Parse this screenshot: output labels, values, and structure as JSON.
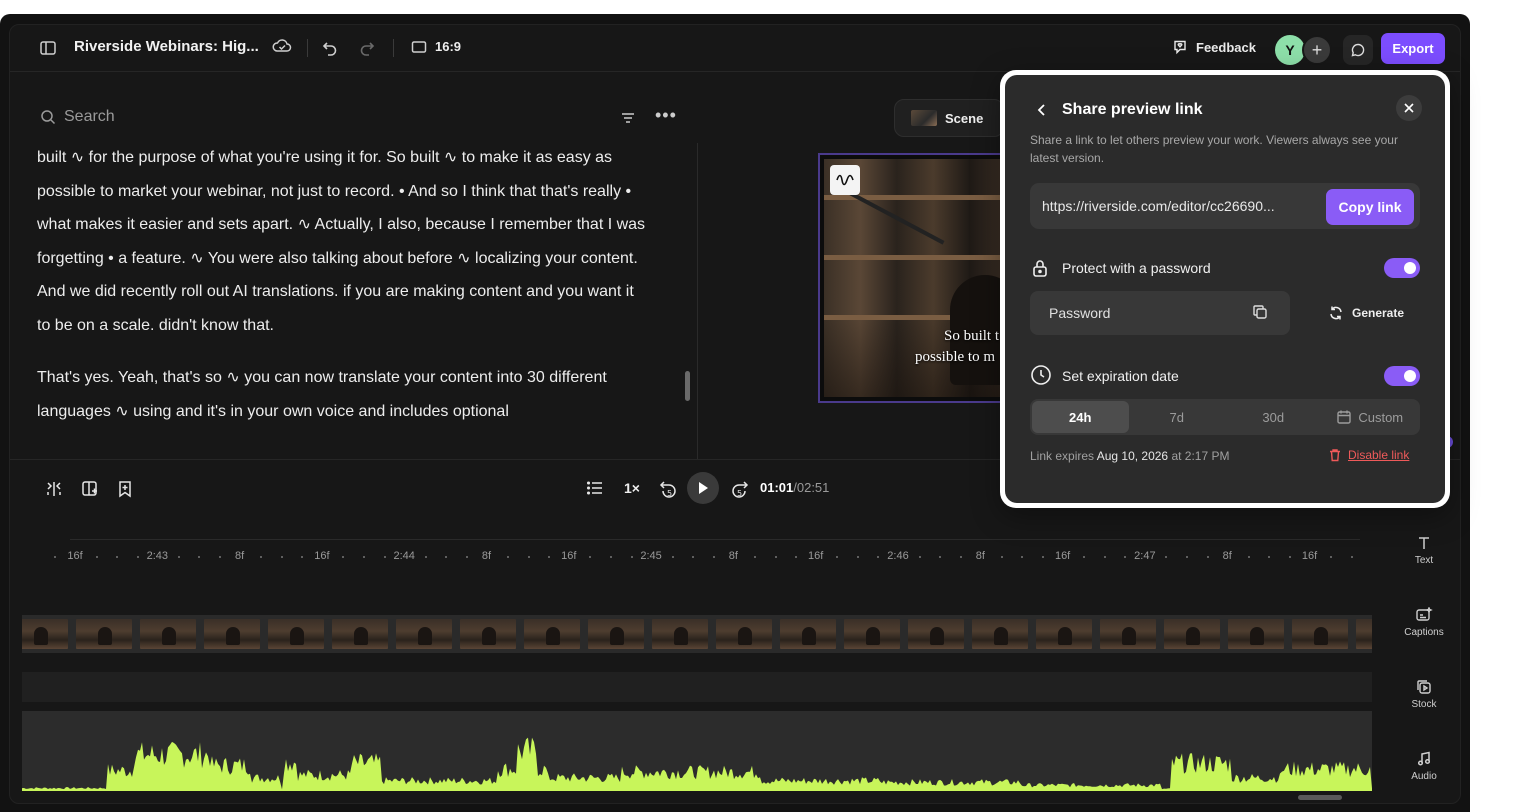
{
  "topbar": {
    "project_title": "Riverside Webinars: Hig...",
    "aspect_ratio": "16:9",
    "feedback_label": "Feedback",
    "avatar_initial": "Y",
    "add_label": "+",
    "export_label": "Export"
  },
  "transcript": {
    "search_placeholder": "Search",
    "paragraphs": [
      "built ∿ for the purpose of what you're using it for. So built ∿ to make it as easy as possible to market your webinar, not just to record. • And so I think that that's really • what makes it easier and sets apart. ∿ Actually, I also, because I remember that I was forgetting • a feature. ∿ You were also talking about before ∿ localizing your content. And we did recently roll out AI translations. if you are making content and you want it to be on a scale. didn't know that.",
      "That's yes. Yeah, that's so ∿ you can now translate your content into 30 different languages ∿ using and it's in your own voice and includes optional"
    ]
  },
  "preview": {
    "scene_label": "Scene",
    "caption_line1": "So built t",
    "caption_line2": "possible to m"
  },
  "player": {
    "speed": "1×",
    "current_time": "01:01",
    "total_time": "/02:51",
    "skip_back": "5",
    "skip_forward": "5"
  },
  "ruler_labels": [
    "16f",
    "2:43",
    "8f",
    "16f",
    "2:44",
    "8f",
    "16f",
    "2:45",
    "8f",
    "16f",
    "2:46",
    "8f",
    "16f",
    "2:47",
    "8f",
    "16f"
  ],
  "tools": [
    {
      "label": "Text",
      "icon": "text-icon"
    },
    {
      "label": "Captions",
      "icon": "captions-icon"
    },
    {
      "label": "Stock",
      "icon": "stock-icon"
    },
    {
      "label": "Audio",
      "icon": "music-note-icon"
    }
  ],
  "share_modal": {
    "title": "Share preview link",
    "description": "Share a link to let others preview your work. Viewers always see your latest version.",
    "link_url": "https://riverside.com/editor/cc26690...",
    "copy_label": "Copy link",
    "password_label": "Protect with a password",
    "password_enabled": true,
    "password_placeholder": "Password",
    "generate_label": "Generate",
    "expiration_label": "Set expiration date",
    "expiration_enabled": true,
    "expiration_options": [
      "24h",
      "7d",
      "30d",
      "Custom"
    ],
    "selected_option": "24h",
    "expires_prefix": "Link expires",
    "expires_date": "Aug 10, 2026",
    "expires_suffix": "at 2:17 PM",
    "disable_label": "Disable link"
  },
  "colors": {
    "accent": "#8a5cf6",
    "waveform": "#c8f55a",
    "danger": "#ef5a5a",
    "background": "#171717"
  }
}
